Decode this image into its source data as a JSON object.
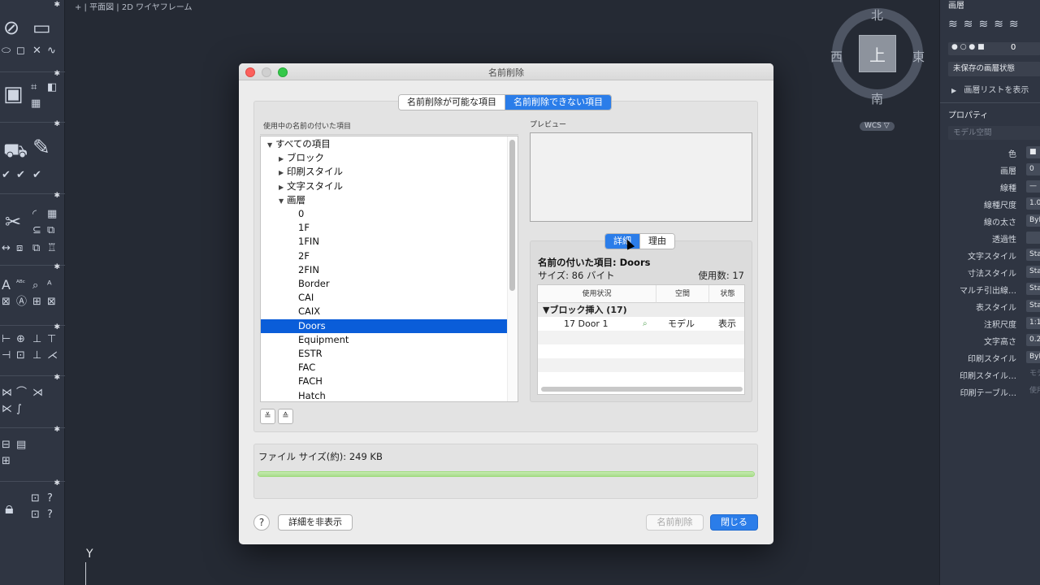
{
  "app": {
    "viewport_label": "+ | 平面図 | 2D ワイヤフレーム",
    "viewcube": {
      "top": "上",
      "north": "北",
      "south": "南",
      "east": "東",
      "west": "西"
    },
    "wcs_label": "WCS ▽",
    "y_axis_label": "Y"
  },
  "right_panel": {
    "layers_title": "画層",
    "layer_current": "0",
    "layer_state": "未保存の画層状態",
    "show_layer_list": "画層リストを表示",
    "properties_title": "プロパティ",
    "space_field": "モデル空間",
    "properties": [
      {
        "label": "色",
        "value": "■"
      },
      {
        "label": "画層",
        "value": "0"
      },
      {
        "label": "線種",
        "value": "—"
      },
      {
        "label": "線種尺度",
        "value": "1.0"
      },
      {
        "label": "線の太さ",
        "value": "ByL"
      },
      {
        "label": "透過性",
        "value": ""
      },
      {
        "label": "文字スタイル",
        "value": "Sta"
      },
      {
        "label": "寸法スタイル",
        "value": "Sta"
      },
      {
        "label": "マルチ引出線…",
        "value": "Sta"
      },
      {
        "label": "表スタイル",
        "value": "Sta"
      },
      {
        "label": "注釈尺度",
        "value": "1:1"
      },
      {
        "label": "文字高さ",
        "value": "0.2"
      },
      {
        "label": "印刷スタイル",
        "value": "ByL"
      },
      {
        "label": "印刷スタイル…",
        "value": "モデ"
      },
      {
        "label": "印刷テーブル…",
        "value": "使用"
      }
    ]
  },
  "dialog": {
    "title": "名前削除",
    "tabs": [
      {
        "label": "名前削除が可能な項目"
      },
      {
        "label": "名前削除できない項目"
      }
    ],
    "tree_header": "使用中の名前の付いた項目",
    "tree": [
      {
        "label": "すべての項目",
        "toggle": "▼",
        "level": 0
      },
      {
        "label": "ブロック",
        "toggle": "▶",
        "level": 1
      },
      {
        "label": "印刷スタイル",
        "toggle": "▶",
        "level": 1
      },
      {
        "label": "文字スタイル",
        "toggle": "▶",
        "level": 1
      },
      {
        "label": "画層",
        "toggle": "▼",
        "level": 1
      },
      {
        "label": "0",
        "toggle": "",
        "level": 2
      },
      {
        "label": "1F",
        "toggle": "",
        "level": 2
      },
      {
        "label": "1FIN",
        "toggle": "",
        "level": 2
      },
      {
        "label": "2F",
        "toggle": "",
        "level": 2
      },
      {
        "label": "2FIN",
        "toggle": "",
        "level": 2
      },
      {
        "label": "Border",
        "toggle": "",
        "level": 2
      },
      {
        "label": "CAI",
        "toggle": "",
        "level": 2
      },
      {
        "label": "CAIX",
        "toggle": "",
        "level": 2
      },
      {
        "label": "Doors",
        "toggle": "",
        "level": 2
      },
      {
        "label": "Equipment",
        "toggle": "",
        "level": 2
      },
      {
        "label": "ESTR",
        "toggle": "",
        "level": 2
      },
      {
        "label": "FAC",
        "toggle": "",
        "level": 2
      },
      {
        "label": "FACH",
        "toggle": "",
        "level": 2
      },
      {
        "label": "Hatch",
        "toggle": "",
        "level": 2
      }
    ],
    "expand_all_icon": "≚",
    "collapse_all_icon": "≙",
    "preview_label": "プレビュー",
    "detail_tabs": [
      {
        "label": "詳細"
      },
      {
        "label": "理由"
      }
    ],
    "detail": {
      "name_line": "名前の付いた項目: Doors",
      "size_line": "サイズ: 86 バイト",
      "count_line": "使用数: 17",
      "columns": [
        "使用状況",
        "空間",
        "状態"
      ],
      "group_row": "▼ブロック挿入 (17)",
      "rows": [
        {
          "usage": "17 Door 1",
          "space": "モデル",
          "state": "表示"
        }
      ]
    },
    "file_size_label": "ファイル サイズ(約): 249 KB",
    "progress": 1.0,
    "help_label": "?",
    "hide_details_button": "詳細を非表示",
    "purge_button": "名前削除",
    "close_button": "閉じる"
  }
}
